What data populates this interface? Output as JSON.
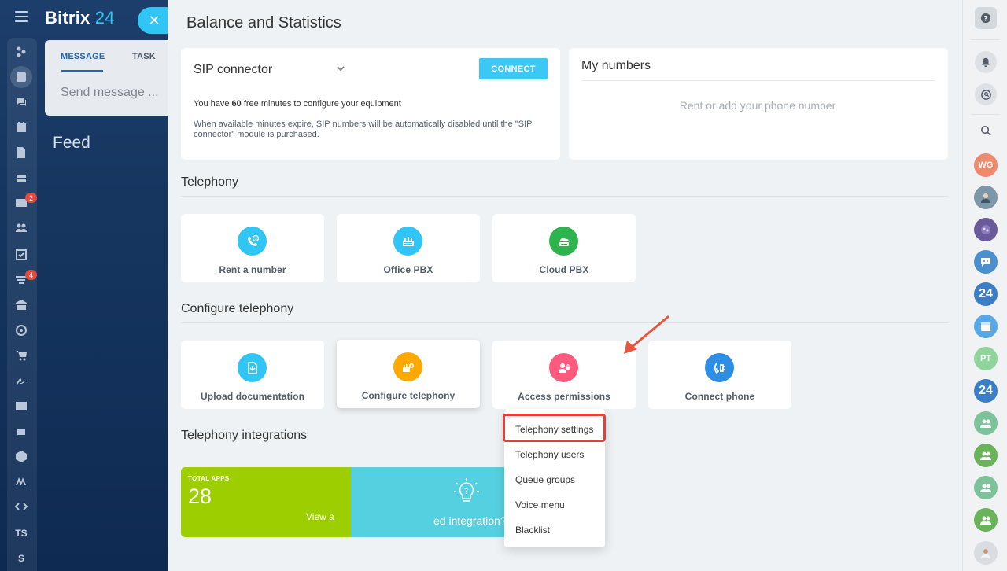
{
  "app": {
    "logo_name": "Bitrix",
    "logo_number": "24"
  },
  "composer": {
    "tab_message": "MESSAGE",
    "tab_task": "TASK",
    "placeholder": "Send message ..."
  },
  "feed": {
    "title": "Feed"
  },
  "sidebar": {
    "badges": {
      "mail": "2",
      "tasks": "4"
    },
    "text_items": {
      "ts": "TS",
      "s": "S"
    }
  },
  "panel": {
    "title": "Balance and Statistics",
    "sip": {
      "title": "SIP connector",
      "connect_label": "CONNECT",
      "free_prefix": "You have ",
      "free_minutes": "60",
      "free_suffix": " free minutes to configure your equipment",
      "note": "When available minutes expire, SIP numbers will be automatically disabled until the \"SIP connector\" module is purchased."
    },
    "my_numbers": {
      "title": "My numbers",
      "empty": "Rent or add your phone number"
    },
    "telephony": {
      "title": "Telephony",
      "tiles": [
        {
          "label": "Rent a number",
          "icon": "phone-dollar-icon",
          "color": "#2fc6f6"
        },
        {
          "label": "Office PBX",
          "icon": "pbx-icon",
          "color": "#2fc6f6"
        },
        {
          "label": "Cloud PBX",
          "icon": "cloud-pbx-icon",
          "color": "#2fb34f"
        }
      ]
    },
    "configure": {
      "title": "Configure telephony",
      "tiles": [
        {
          "label": "Upload documentation",
          "icon": "upload-document-icon",
          "color": "#2fc6f6"
        },
        {
          "label": "Configure telephony",
          "icon": "settings-gear-icon",
          "color": "#ffa900"
        },
        {
          "label": "Access permissions",
          "icon": "user-lock-icon",
          "color": "#ff5b7f"
        },
        {
          "label": "Connect phone",
          "icon": "phone-plug-icon",
          "color": "#2d8ee4"
        }
      ]
    },
    "menu": {
      "items": [
        "Telephony settings",
        "Telephony users",
        "Queue groups",
        "Voice menu",
        "Blacklist"
      ]
    },
    "integrations": {
      "title": "Telephony integrations",
      "total_label": "TOTAL APPS",
      "total": "28",
      "view_label": "View a",
      "need_label": "ed integration?"
    }
  },
  "rightbar": {
    "avatars": [
      "WG",
      "PT"
    ],
    "labels": {
      "b24": "24"
    }
  },
  "colors": {
    "accent": "#2fc6f6",
    "highlight": "#e43f3b",
    "apps_green": "#9dcf00",
    "apps_blue": "#55d0e0"
  }
}
